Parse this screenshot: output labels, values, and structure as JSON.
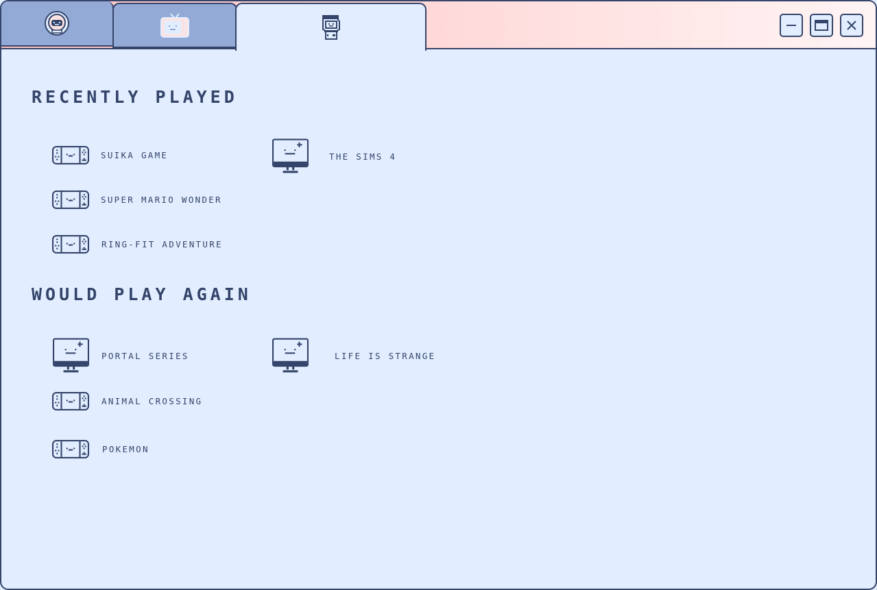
{
  "tabs": [
    {
      "icon": "robot-face-icon",
      "active": false
    },
    {
      "icon": "tv-icon",
      "active": false
    },
    {
      "icon": "arcade-machine-icon",
      "active": true
    }
  ],
  "window_controls": {
    "minimize_icon": "minimize-icon",
    "maximize_icon": "maximize-icon",
    "close_icon": "close-icon"
  },
  "sections": {
    "recently_played": {
      "title": "RECENTLY PLAYED",
      "games": [
        {
          "name": "SUIKA GAME",
          "platform": "handheld-console-icon"
        },
        {
          "name": "THE SIMS 4",
          "platform": "computer-monitor-icon"
        },
        {
          "name": "SUPER MARIO WONDER",
          "platform": "handheld-console-icon"
        },
        {
          "name": "RING-FIT ADVENTURE",
          "platform": "handheld-console-icon"
        }
      ]
    },
    "would_play_again": {
      "title": "WOULD PLAY AGAIN",
      "games": [
        {
          "name": "PORTAL SERIES",
          "platform": "computer-monitor-icon"
        },
        {
          "name": "LIFE IS STRANGE",
          "platform": "computer-monitor-icon"
        },
        {
          "name": "ANIMAL CROSSING",
          "platform": "handheld-console-icon"
        },
        {
          "name": "POKEMON",
          "platform": "handheld-console-icon"
        }
      ]
    }
  },
  "colors": {
    "outline": "#34446a",
    "background": "#e2eeff",
    "inactive_tab": "#93aad6",
    "titlebar_gradient_start": "#ffc4c4",
    "titlebar_gradient_end": "#fff4f4"
  }
}
